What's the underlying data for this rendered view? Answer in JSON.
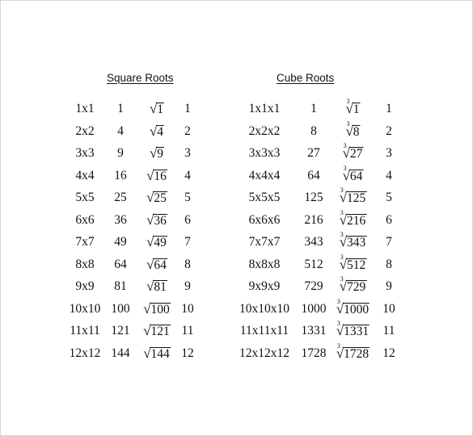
{
  "square_roots": {
    "title": "Square Roots",
    "rows": [
      {
        "expr": "1x1",
        "value": "1",
        "radicand": "1",
        "root": "1"
      },
      {
        "expr": "2x2",
        "value": "4",
        "radicand": "4",
        "root": "2"
      },
      {
        "expr": "3x3",
        "value": "9",
        "radicand": "9",
        "root": "3"
      },
      {
        "expr": "4x4",
        "value": "16",
        "radicand": "16",
        "root": "4"
      },
      {
        "expr": "5x5",
        "value": "25",
        "radicand": "25",
        "root": "5"
      },
      {
        "expr": "6x6",
        "value": "36",
        "radicand": "36",
        "root": "6"
      },
      {
        "expr": "7x7",
        "value": "49",
        "radicand": "49",
        "root": "7"
      },
      {
        "expr": "8x8",
        "value": "64",
        "radicand": "64",
        "root": "8"
      },
      {
        "expr": "9x9",
        "value": "81",
        "radicand": "81",
        "root": "9"
      },
      {
        "expr": "10x10",
        "value": "100",
        "radicand": "100",
        "root": "10"
      },
      {
        "expr": "11x11",
        "value": "121",
        "radicand": "121",
        "root": "11"
      },
      {
        "expr": "12x12",
        "value": "144",
        "radicand": "144",
        "root": "12"
      }
    ]
  },
  "cube_roots": {
    "title": "Cube Roots",
    "index": "3",
    "rows": [
      {
        "expr": "1x1x1",
        "value": "1",
        "radicand": "1",
        "root": "1"
      },
      {
        "expr": "2x2x2",
        "value": "8",
        "radicand": "8",
        "root": "2"
      },
      {
        "expr": "3x3x3",
        "value": "27",
        "radicand": "27",
        "root": "3"
      },
      {
        "expr": "4x4x4",
        "value": "64",
        "radicand": "64",
        "root": "4"
      },
      {
        "expr": "5x5x5",
        "value": "125",
        "radicand": "125",
        "root": "5"
      },
      {
        "expr": "6x6x6",
        "value": "216",
        "radicand": "216",
        "root": "6"
      },
      {
        "expr": "7x7x7",
        "value": "343",
        "radicand": "343",
        "root": "7"
      },
      {
        "expr": "8x8x8",
        "value": "512",
        "radicand": "512",
        "root": "8"
      },
      {
        "expr": "9x9x9",
        "value": "729",
        "radicand": "729",
        "root": "9"
      },
      {
        "expr": "10x10x10",
        "value": "1000",
        "radicand": "1000",
        "root": "10"
      },
      {
        "expr": "11x11x11",
        "value": "1331",
        "radicand": "1331",
        "root": "11"
      },
      {
        "expr": "12x12x12",
        "value": "1728",
        "radicand": "1728",
        "root": "12"
      }
    ]
  },
  "radical_symbol": "√"
}
